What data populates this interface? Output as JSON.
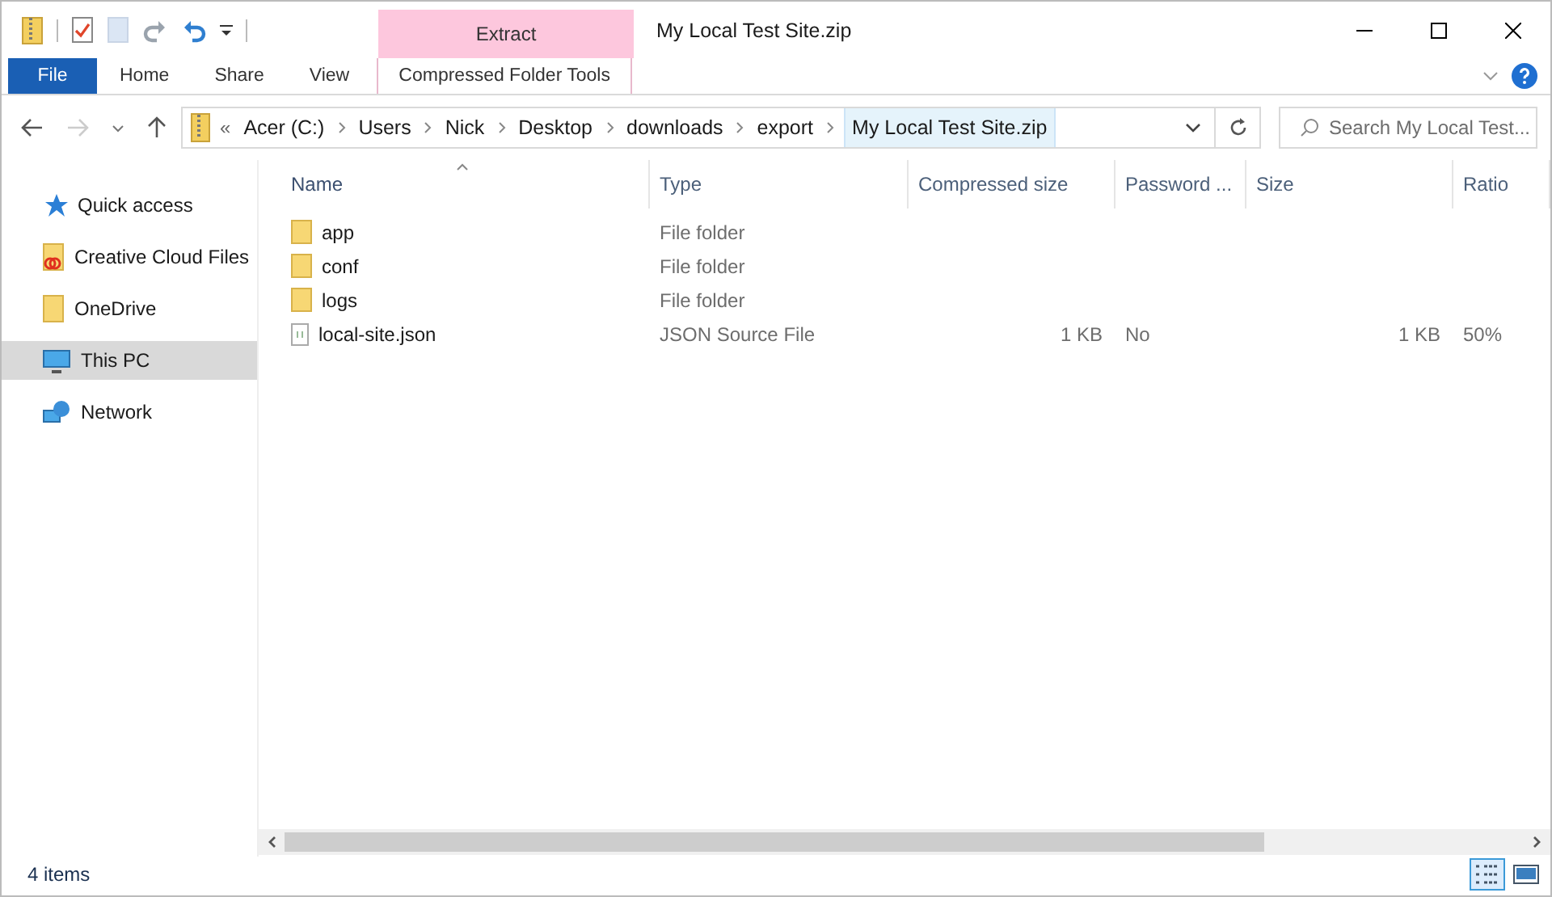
{
  "window": {
    "title": "My Local Test Site.zip"
  },
  "contextual_tab": {
    "header": "Extract",
    "label": "Compressed Folder Tools"
  },
  "ribbon_tabs": [
    {
      "label": "File",
      "kind": "file"
    },
    {
      "label": "Home",
      "kind": "normal"
    },
    {
      "label": "Share",
      "kind": "normal"
    },
    {
      "label": "View",
      "kind": "normal"
    }
  ],
  "address": {
    "overflow_mark": "«",
    "crumbs": [
      {
        "label": "Acer (C:)",
        "selected": false
      },
      {
        "label": "Users",
        "selected": false
      },
      {
        "label": "Nick",
        "selected": false
      },
      {
        "label": "Desktop",
        "selected": false
      },
      {
        "label": "downloads",
        "selected": false
      },
      {
        "label": "export",
        "selected": false
      },
      {
        "label": "My Local Test Site.zip",
        "selected": true
      }
    ]
  },
  "search": {
    "placeholder": "Search My Local Test..."
  },
  "sidebar": {
    "items": [
      {
        "label": "Quick access",
        "kind": "star",
        "selected": false
      },
      {
        "label": "Creative Cloud Files",
        "kind": "cloud-folder",
        "selected": false
      },
      {
        "label": "OneDrive",
        "kind": "folder",
        "selected": false
      },
      {
        "label": "This PC",
        "kind": "pc",
        "selected": true
      },
      {
        "label": "Network",
        "kind": "network",
        "selected": false
      }
    ]
  },
  "table": {
    "columns": [
      {
        "label": "Name",
        "sorted": true
      },
      {
        "label": "Type",
        "sorted": false
      },
      {
        "label": "Compressed size",
        "sorted": false
      },
      {
        "label": "Password ...",
        "sorted": false
      },
      {
        "label": "Size",
        "sorted": false
      },
      {
        "label": "Ratio",
        "sorted": false
      }
    ],
    "rows": [
      {
        "kind": "folder",
        "cells": [
          "app",
          "File folder"
        ]
      },
      {
        "kind": "folder",
        "cells": [
          "conf",
          "File folder"
        ]
      },
      {
        "kind": "folder",
        "cells": [
          "logs",
          "File folder"
        ]
      },
      {
        "kind": "file",
        "cells": [
          "local-site.json",
          "JSON Source File",
          "1 KB",
          "No",
          "1 KB",
          "50%"
        ]
      }
    ]
  },
  "status_bar": {
    "count": "4 items",
    "views": [
      {
        "kind": "details",
        "selected": true
      },
      {
        "kind": "large-icons",
        "selected": false
      }
    ]
  }
}
